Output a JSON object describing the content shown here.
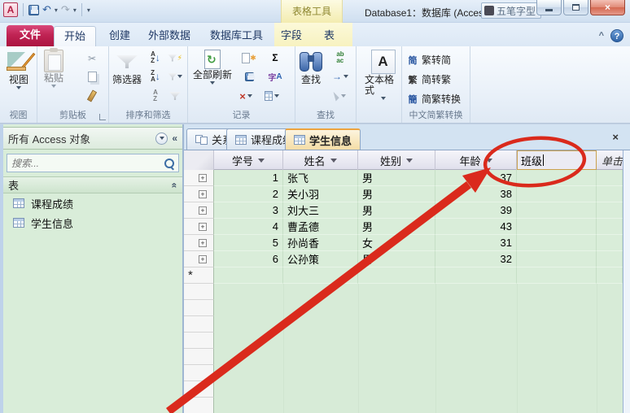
{
  "titlebar": {
    "app_letter": "A",
    "contextual_tool_label": "表格工具",
    "title": "Database1：数据库 (Acces",
    "ime_badge": "五笔字型"
  },
  "ribbon_tabs": {
    "file": "文件",
    "home": "开始",
    "create": "创建",
    "external_data": "外部数据",
    "database_tools": "数据库工具",
    "fields": "字段",
    "table": "表"
  },
  "ribbon": {
    "view": {
      "button": "视图",
      "group": "视图"
    },
    "clipboard": {
      "paste": "粘贴",
      "group": "剪贴板"
    },
    "sort_filter": {
      "filter": "筛选器",
      "group": "排序和筛选"
    },
    "records": {
      "refresh_all": "全部刷新",
      "group": "记录"
    },
    "find": {
      "find": "查找",
      "group": "查找"
    },
    "text_format": {
      "label": "文本格式",
      "letter": "A"
    },
    "chinese_conversion": {
      "items": [
        "繁转简",
        "简转繁",
        "简繁转换"
      ],
      "group": "中文简繁转换"
    }
  },
  "icons": {
    "undo": "↶",
    "redo": "↷",
    "qat_more": "▾",
    "scissors": "✂",
    "copy_label": "",
    "sigma": "Σ",
    "close_x": "×",
    "delete_x": "×",
    "help": "?",
    "ribbon_caret": "^",
    "collapse_left": "«",
    "sort_a": "A",
    "sort_z": "Z",
    "arrow_down": "↓",
    "goto_arrow": "→",
    "replace_ab": "ab",
    "replace_ac": "ac",
    "spell_zi": "字",
    "hanzi_jian": "简",
    "hanzi_fan": "繁",
    "hanzi_jianfan": "簡",
    "new_star": "✱",
    "plus": "+"
  },
  "nav_pane": {
    "header": "所有 Access 对象",
    "search_placeholder": "搜索...",
    "section_label": "表",
    "items": [
      "课程成绩",
      "学生信息"
    ]
  },
  "doc_tabs": [
    "关系",
    "课程成绩",
    "学生信息"
  ],
  "datasheet": {
    "columns": [
      "学号",
      "姓名",
      "姓别",
      "年龄"
    ],
    "editing_column_name": "班级",
    "click_to_add_partial": "单击",
    "new_row_marker": "*",
    "rows": [
      {
        "id": "1",
        "name": "张飞",
        "gender": "男",
        "age": "37"
      },
      {
        "id": "2",
        "name": "关小羽",
        "gender": "男",
        "age": "38"
      },
      {
        "id": "3",
        "name": "刘大三",
        "gender": "男",
        "age": "39"
      },
      {
        "id": "4",
        "name": "曹孟德",
        "gender": "男",
        "age": "43"
      },
      {
        "id": "5",
        "name": "孙尚香",
        "gender": "女",
        "age": "31"
      },
      {
        "id": "6",
        "name": "公孙策",
        "gender": "男",
        "age": "32"
      }
    ]
  },
  "annotation_colors": {
    "red": "#da2a1c"
  }
}
